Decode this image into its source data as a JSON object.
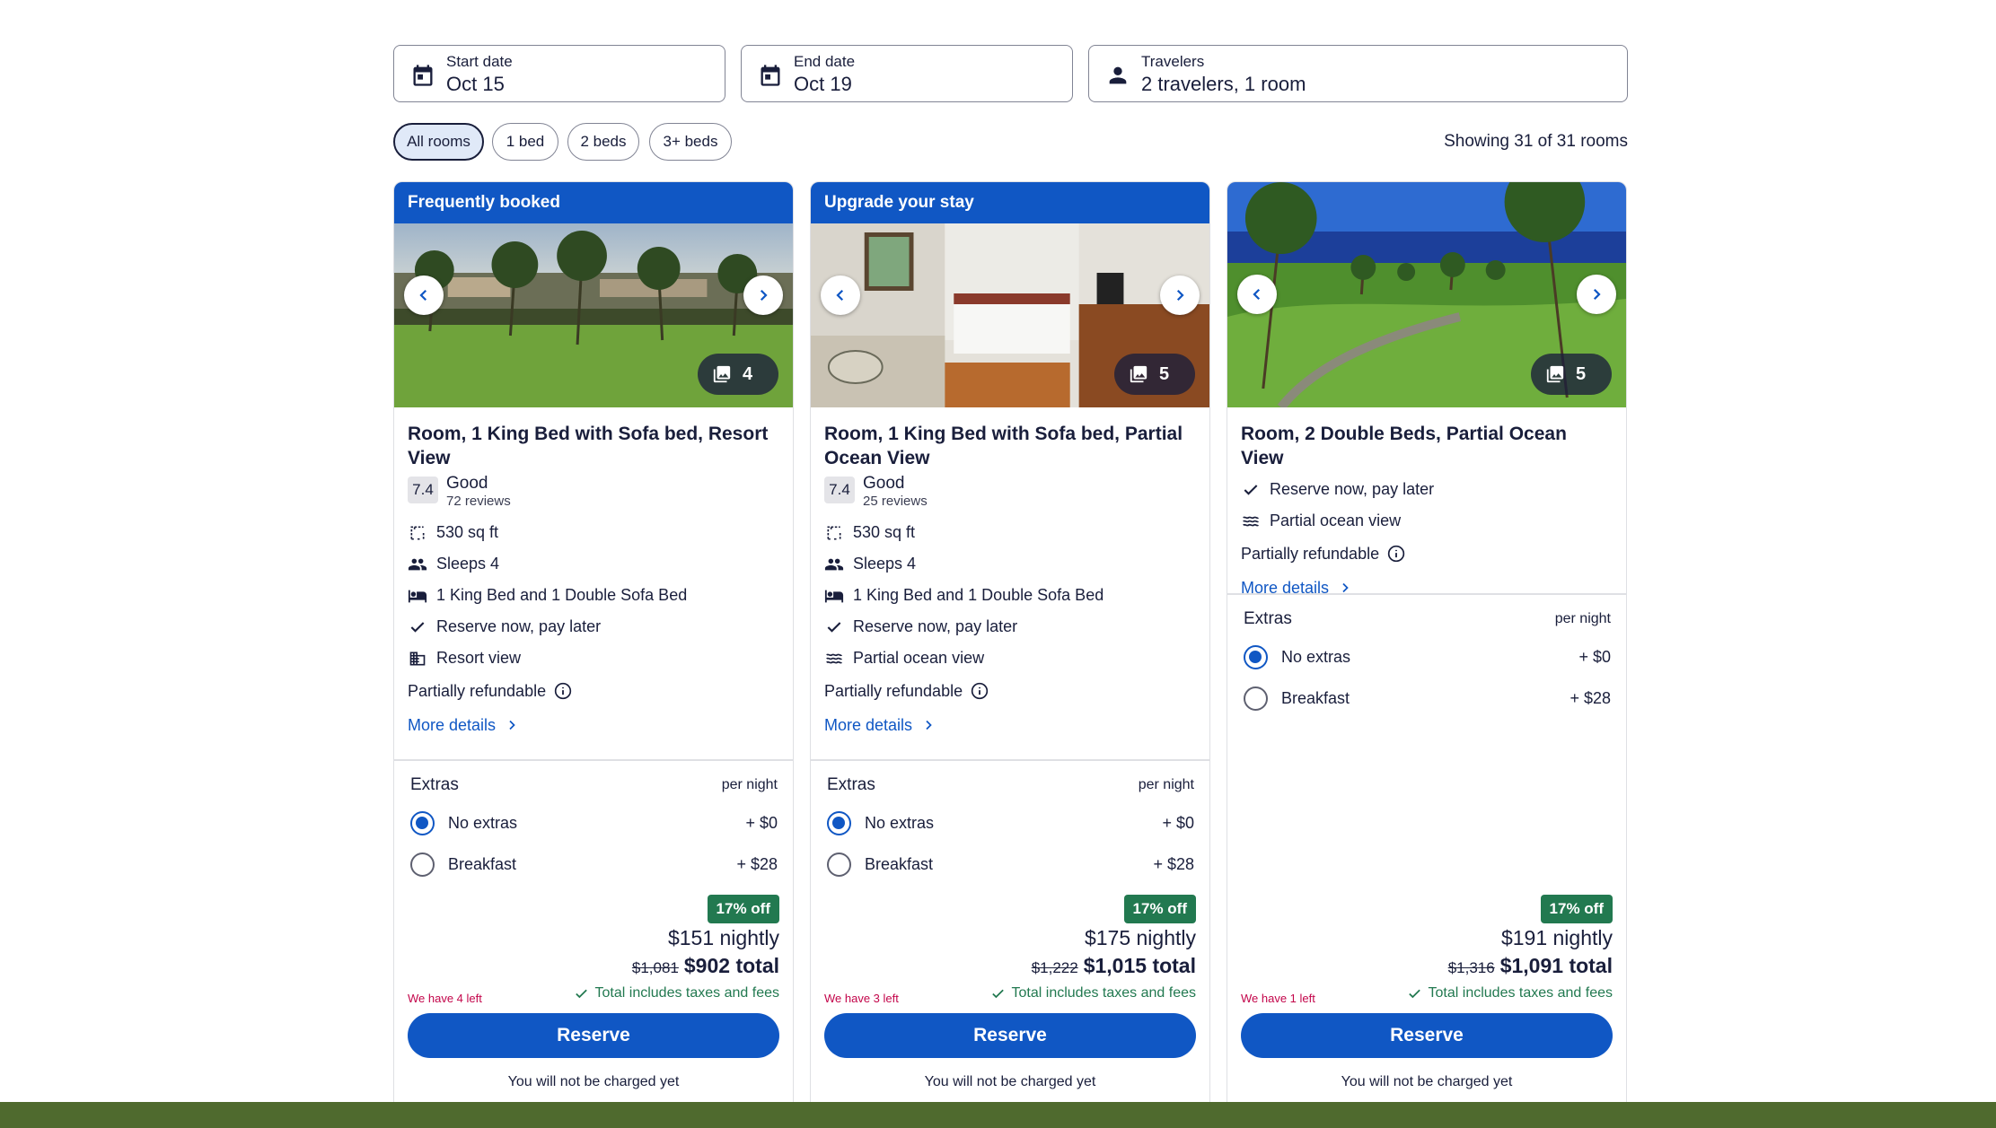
{
  "search": {
    "start": {
      "label": "Start date",
      "value": "Oct 15"
    },
    "end": {
      "label": "End date",
      "value": "Oct 19"
    },
    "travelers": {
      "label": "Travelers",
      "value": "2 travelers, 1 room"
    }
  },
  "filters": {
    "pills": [
      "All rooms",
      "1 bed",
      "2 beds",
      "3+ beds"
    ],
    "active": "All rooms",
    "showing": "Showing 31 of 31 rooms"
  },
  "colors": {
    "brand_blue": "#1057c4",
    "deal_green": "#227950",
    "urgent_red": "#c3054a"
  },
  "cards": [
    {
      "badge": "Frequently booked",
      "photo_count": "4",
      "title": "Room, 1 King Bed with Sofa bed, Resort View",
      "rating": {
        "score": "7.4",
        "word": "Good",
        "reviews": "72 reviews"
      },
      "amenities": [
        {
          "icon": "floor-plan-icon",
          "text": "530 sq ft"
        },
        {
          "icon": "people-icon",
          "text": "Sleeps 4"
        },
        {
          "icon": "bed-icon",
          "text": "1 King Bed and 1 Double Sofa Bed"
        },
        {
          "icon": "check-icon",
          "text": "Reserve now, pay later"
        },
        {
          "icon": "building-icon",
          "text": "Resort view"
        }
      ],
      "refund": "Partially refundable",
      "more": "More details",
      "extras": {
        "title": "Extras",
        "per": "per night",
        "options": [
          {
            "label": "No extras",
            "price": "+ $0",
            "selected": true
          },
          {
            "label": "Breakfast",
            "price": "+ $28",
            "selected": false
          }
        ]
      },
      "discount": "17% off",
      "nightly": "$151 nightly",
      "old_total": "$1,081",
      "total": "$902 total",
      "left": "We have 4 left",
      "includes": "Total includes taxes and fees",
      "reserve": "Reserve",
      "no_charge": "You will not be charged yet"
    },
    {
      "badge": "Upgrade your stay",
      "photo_count": "5",
      "title": "Room, 1 King Bed with Sofa bed, Partial Ocean View",
      "rating": {
        "score": "7.4",
        "word": "Good",
        "reviews": "25 reviews"
      },
      "amenities": [
        {
          "icon": "floor-plan-icon",
          "text": "530 sq ft"
        },
        {
          "icon": "people-icon",
          "text": "Sleeps 4"
        },
        {
          "icon": "bed-icon",
          "text": "1 King Bed and 1 Double Sofa Bed"
        },
        {
          "icon": "check-icon",
          "text": "Reserve now, pay later"
        },
        {
          "icon": "waves-icon",
          "text": "Partial ocean view"
        }
      ],
      "refund": "Partially refundable",
      "more": "More details",
      "extras": {
        "title": "Extras",
        "per": "per night",
        "options": [
          {
            "label": "No extras",
            "price": "+ $0",
            "selected": true
          },
          {
            "label": "Breakfast",
            "price": "+ $28",
            "selected": false
          }
        ]
      },
      "discount": "17% off",
      "nightly": "$175 nightly",
      "old_total": "$1,222",
      "total": "$1,015 total",
      "left": "We have 3 left",
      "includes": "Total includes taxes and fees",
      "reserve": "Reserve",
      "no_charge": "You will not be charged yet"
    },
    {
      "photo_count": "5",
      "title": "Room, 2 Double Beds, Partial Ocean View",
      "amenities": [
        {
          "icon": "check-icon",
          "text": "Reserve now, pay later"
        },
        {
          "icon": "waves-icon",
          "text": "Partial ocean view"
        }
      ],
      "refund": "Partially refundable",
      "more": "More details",
      "extras": {
        "title": "Extras",
        "per": "per night",
        "options": [
          {
            "label": "No extras",
            "price": "+ $0",
            "selected": true
          },
          {
            "label": "Breakfast",
            "price": "+ $28",
            "selected": false
          }
        ]
      },
      "discount": "17% off",
      "nightly": "$191 nightly",
      "old_total": "$1,316",
      "total": "$1,091 total",
      "left": "We have 1 left",
      "includes": "Total includes taxes and fees",
      "reserve": "Reserve",
      "no_charge": "You will not be charged yet"
    }
  ]
}
